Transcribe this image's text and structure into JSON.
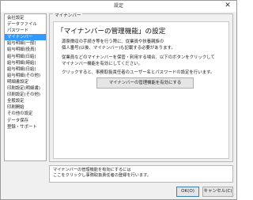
{
  "window": {
    "title": "設定",
    "close_glyph": "✕"
  },
  "sidebar": {
    "items": [
      {
        "label": "会社設定",
        "selected": false
      },
      {
        "label": "データファイル",
        "selected": false
      },
      {
        "label": "パスワード",
        "selected": false
      },
      {
        "label": "マイナンバー",
        "selected": true
      },
      {
        "label": "給与明細(一般)",
        "selected": false
      },
      {
        "label": "給与明細(役員)",
        "selected": false
      },
      {
        "label": "給与明細(日給)",
        "selected": false
      },
      {
        "label": "給与明細(時給)",
        "selected": false
      },
      {
        "label": "給与明細(日給)",
        "selected": false
      },
      {
        "label": "給与明細(その他)",
        "selected": false
      },
      {
        "label": "明細書設定",
        "selected": false
      },
      {
        "label": "印刷設定(明細書)",
        "selected": false
      },
      {
        "label": "印刷設定(その他)",
        "selected": false
      },
      {
        "label": "全般設定",
        "selected": false
      },
      {
        "label": "印刷開始",
        "selected": false
      },
      {
        "label": "その他の設定",
        "selected": false
      },
      {
        "label": "データ保存",
        "selected": false
      },
      {
        "label": "登録・サポート",
        "selected": false
      }
    ]
  },
  "panel": {
    "legend": "マイナンバー",
    "heading": "「マイナンバーの管理機能」の設定",
    "para1": [
      "源泉徴収の手続き等を行う際に、従業員や扶養親族の",
      "個人番号(以後、マイナンバー)も記載する必要があります。"
    ],
    "para2": [
      "従業員などのマイナンバーを保管・利用する場合、以下のボタンをクリックして",
      "マイナンバー機能を有効にしてください。"
    ],
    "para3": [
      "クリックすると、事務取扱責任者のユーザー名とパスワードの設定を行います。"
    ],
    "enable_button": "マイナンバーの管理機能を有効にする"
  },
  "help": {
    "lines": [
      "マイナンバーの管理機能を有効にするには",
      "ここをクリックし事務取扱責任者の登録を行います。"
    ]
  },
  "footer": {
    "ok_label": "OK(O)",
    "cancel_label": "キャンセル(C)"
  }
}
